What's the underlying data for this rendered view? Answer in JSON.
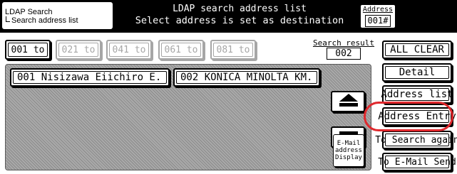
{
  "header": {
    "breadcrumb_1": "LDAP Search",
    "breadcrumb_2": "Search address list",
    "title_1": "LDAP search address list",
    "title_2": "Select address is set as destination",
    "address_label": "Address",
    "address_value": "001#"
  },
  "pages": [
    {
      "label": "001 to",
      "enabled": true
    },
    {
      "label": "021 to",
      "enabled": false
    },
    {
      "label": "041 to",
      "enabled": false
    },
    {
      "label": "061 to",
      "enabled": false
    },
    {
      "label": "081 to",
      "enabled": false
    }
  ],
  "search_result": {
    "label": "Search result",
    "value": "002"
  },
  "entries": [
    {
      "label": "001 Nisizawa Eiichiro E."
    },
    {
      "label": "002 KONICA MINOLTA KM."
    }
  ],
  "panel": {
    "email_display_1": "E-Mail",
    "email_display_2": "address",
    "email_display_3": "Display"
  },
  "actions": {
    "all_clear": "ALL CLEAR",
    "detail": "Detail",
    "address_list": "Address list",
    "address_entry": "Address Entry",
    "to_search_again": "To Search again",
    "to_email_send": "To E-Mail Send"
  },
  "icons": {
    "scroll_up": "arrow-up-icon",
    "scroll_down": "arrow-down-icon"
  },
  "colors": {
    "highlight": "#e0282d",
    "header_bg": "#000000",
    "panel_bg": "#a9a9a9"
  }
}
